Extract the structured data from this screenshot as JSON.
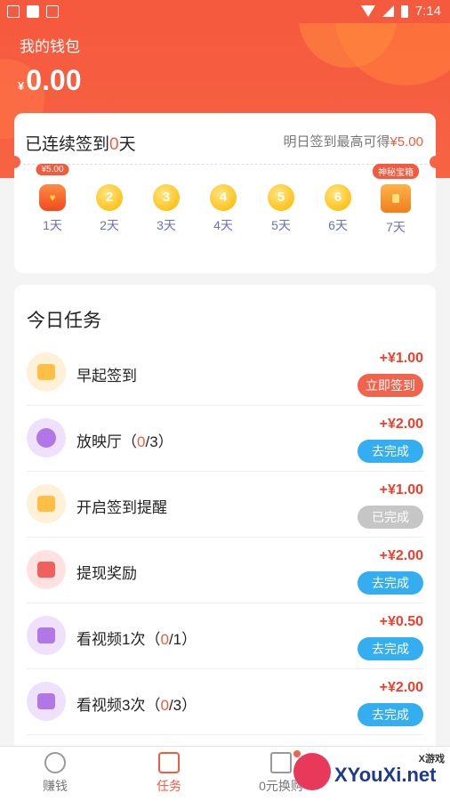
{
  "status_bar": {
    "time": "7:14"
  },
  "header": {
    "wallet_label": "我的钱包",
    "currency": "¥",
    "balance": "0.00"
  },
  "checkin": {
    "prefix": "已连续签到",
    "days": "0",
    "suffix": "天",
    "tomorrow_text": "明日签到最高可得",
    "tomorrow_amount": "¥5.00",
    "today_badge": "¥5.00",
    "chest_badge": "神秘宝箱",
    "days_list": [
      {
        "label": "1天",
        "coin": ""
      },
      {
        "label": "2天",
        "coin": "2"
      },
      {
        "label": "3天",
        "coin": "3"
      },
      {
        "label": "4天",
        "coin": "4"
      },
      {
        "label": "5天",
        "coin": "5"
      },
      {
        "label": "6天",
        "coin": "6"
      },
      {
        "label": "7天",
        "coin": ""
      }
    ]
  },
  "tasks": {
    "title": "今日任务",
    "items": [
      {
        "name": "早起签到",
        "progress_open": "",
        "progress_done": "",
        "progress_total": "",
        "reward": "+¥1.00",
        "button": "立即签到"
      },
      {
        "name": "放映厅",
        "progress_open": "（",
        "progress_done": "0",
        "progress_total": "/3）",
        "reward": "+¥2.00",
        "button": "去完成"
      },
      {
        "name": "开启签到提醒",
        "progress_open": "",
        "progress_done": "",
        "progress_total": "",
        "reward": "+¥1.00",
        "button": "已完成"
      },
      {
        "name": "提现奖励",
        "progress_open": "",
        "progress_done": "",
        "progress_total": "",
        "reward": "+¥2.00",
        "button": "去完成"
      },
      {
        "name": "看视频1次",
        "progress_open": "（",
        "progress_done": "0",
        "progress_total": "/1）",
        "reward": "+¥0.50",
        "button": "去完成"
      },
      {
        "name": "看视频3次",
        "progress_open": "（",
        "progress_done": "0",
        "progress_total": "/3）",
        "reward": "+¥2.00",
        "button": "去完成"
      }
    ]
  },
  "tabbar": {
    "tabs": [
      {
        "label": "赚钱"
      },
      {
        "label": "任务"
      },
      {
        "label": "0元换购"
      }
    ]
  },
  "watermark": {
    "small": "X游戏",
    "big": "XYouXi.net"
  },
  "colors": {
    "accent": "#f65a3e",
    "blue_button": "#33aef0",
    "gray_button": "#c6c6c6",
    "day_label": "#6b73b8"
  }
}
